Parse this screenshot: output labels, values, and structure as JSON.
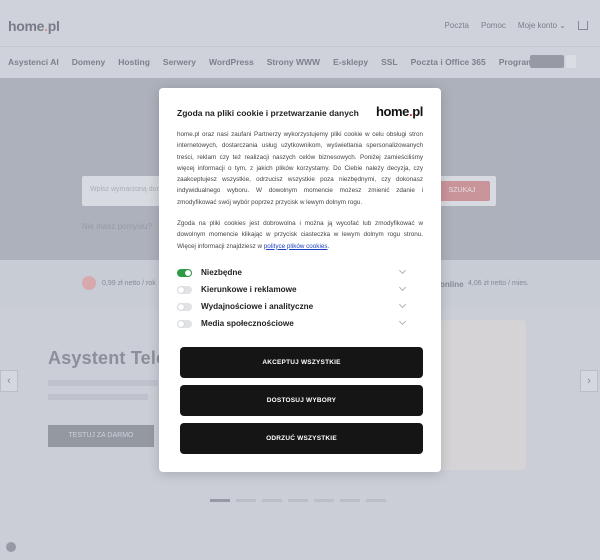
{
  "site": {
    "logo": {
      "text": "home",
      "dot": ".",
      "suffix": "pl"
    },
    "top_links": [
      "Poczta",
      "Pomoc",
      "Moje konto"
    ],
    "nav": [
      "Asystenci AI",
      "Domeny",
      "Hosting",
      "Serwery",
      "WordPress",
      "Strony WWW",
      "E-sklepy",
      "SSL",
      "Poczta i Office 365",
      "Programy"
    ],
    "search": {
      "placeholder": "Wpisz wymarzoną domenę",
      "button": "SZUKAJ"
    },
    "hero_hint": "Nie masz pomysłu?",
    "promo": {
      "left_price": "0,99 zł netto / rok",
      "right_title": "online",
      "right_price": "4,06 zł netto / mies."
    },
    "section": {
      "title": "Asystent Telefo",
      "button": "TESTUJ ZA DARMO"
    },
    "slider": {
      "left": "‹",
      "right": "›",
      "dots": 7,
      "active": 0
    }
  },
  "consent": {
    "title": "Zgoda na pliki cookie i przetwarzanie danych",
    "logo": {
      "text": "home",
      "dot": ".",
      "suffix": "pl"
    },
    "paragraph1": "home.pl oraz nasi zaufani Partnerzy wykorzystujemy pliki cookie w celu obsługi stron internetowych, dostarczania usług użytkownikom, wyświetlania spersonalizowanych treści, reklam czy też realizacji naszych celów biznesowych. Poniżej zamieściliśmy więcej informacji o tym, z jakich plików korzystamy. Do Ciebie należy decyzja, czy zaakceptujesz wszystkie, odrzucisz wszystkie poza niezbędnymi, czy dokonasz indywidualnego wyboru. W dowolnym momencie możesz zmienić zdanie i zmodyfikować swój wybór poprzez przycisk w lewym dolnym rogu.",
    "paragraph2": "Zgoda na pliki cookies jest dobrowolna i można ją wycofać lub zmodyfikować w dowolnym momencie klikając w przycisk ciasteczka w lewym dolnym rogu stronu. Więcej informacji znajdziesz w ",
    "policy_link": "polityce plików cookies",
    "paragraph2_end": ".",
    "categories": [
      {
        "label": "Niezbędne",
        "enabled": true
      },
      {
        "label": "Kierunkowe i reklamowe",
        "enabled": false
      },
      {
        "label": "Wydajnościowe i analityczne",
        "enabled": false
      },
      {
        "label": "Media społecznościowe",
        "enabled": false
      }
    ],
    "buttons": {
      "accept_all": "AKCEPTUJ WSZYSTKIE",
      "customize": "DOSTOSUJ WYBORY",
      "reject_all": "ODRZUĆ WSZYSTKIE"
    }
  }
}
